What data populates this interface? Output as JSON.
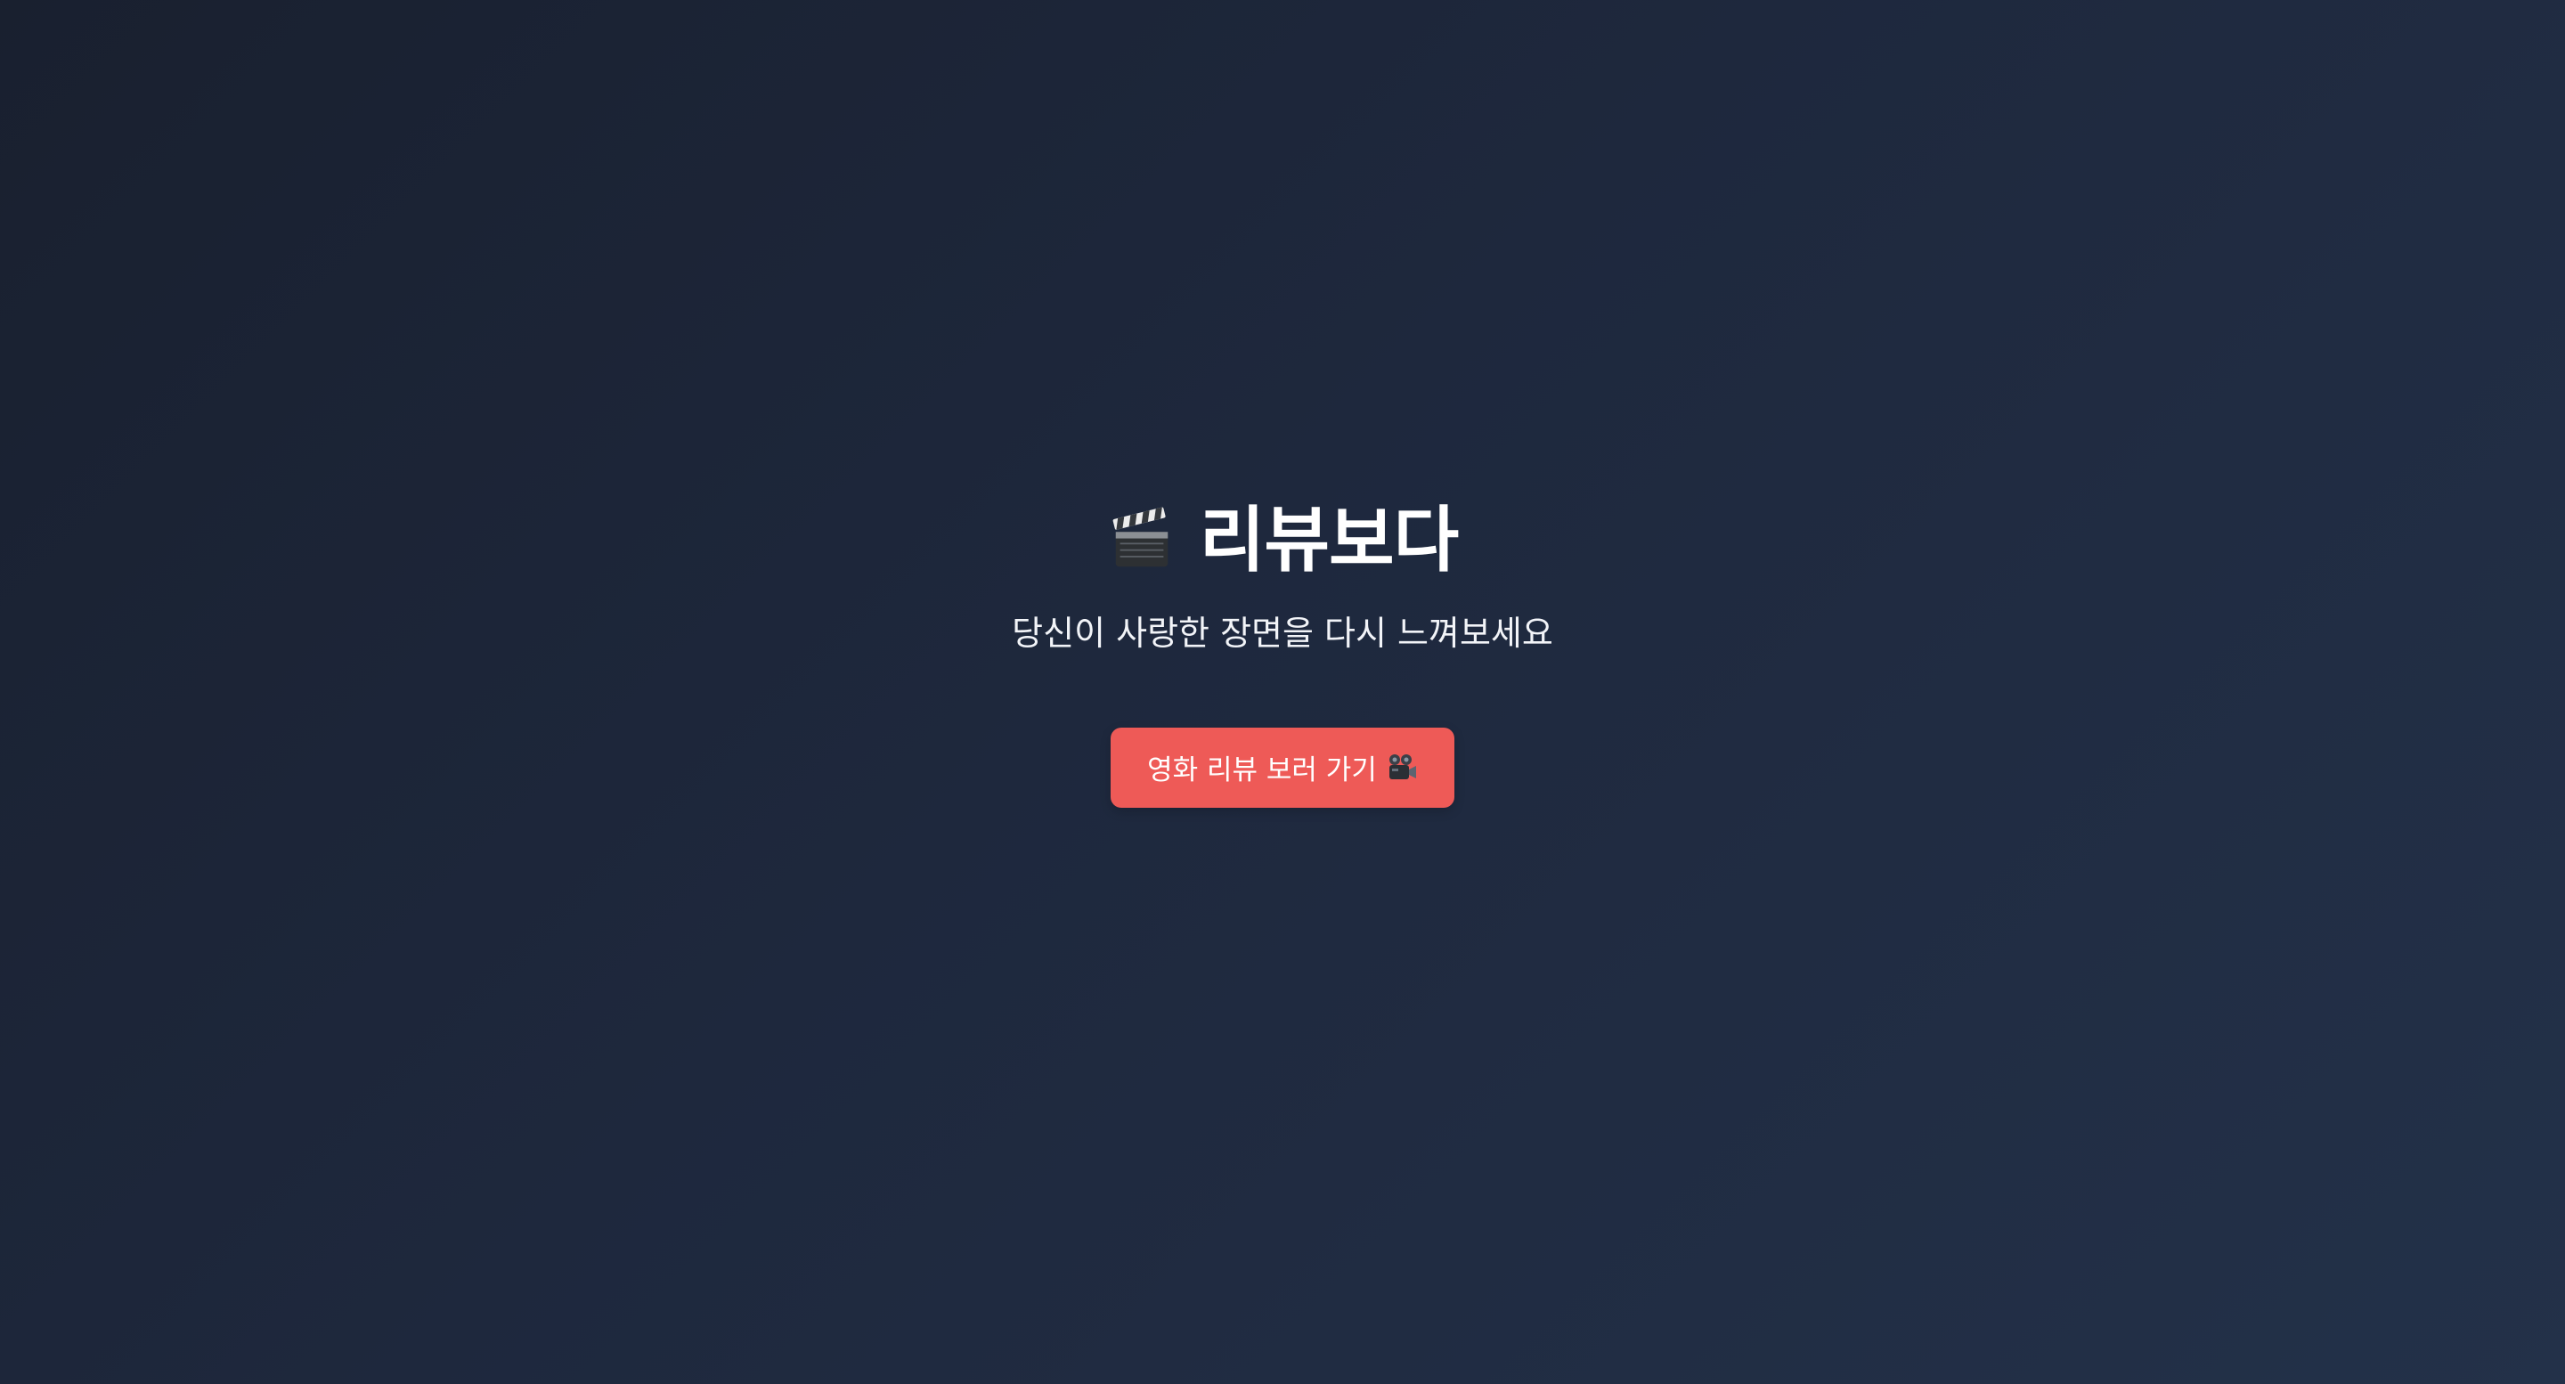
{
  "hero": {
    "title": "리뷰보다",
    "title_icon": "clapperboard-icon",
    "subtitle": "당신이 사랑한 장면을 다시 느껴보세요",
    "cta_label": "영화 리뷰 보러 가기",
    "cta_icon": "movie-camera-icon"
  },
  "colors": {
    "background_top_left": "#19202f",
    "background_bottom_right": "#233149",
    "accent": "#ee5a57",
    "text": "#ffffff"
  }
}
